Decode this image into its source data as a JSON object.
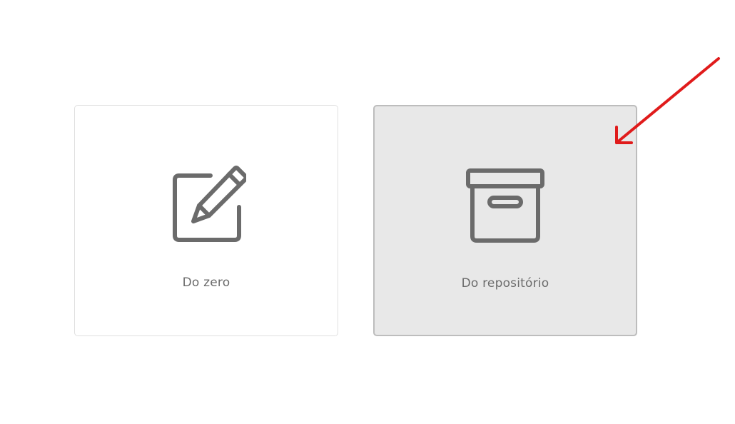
{
  "options": [
    {
      "label": "Do zero",
      "icon": "edit-pencil-square-icon",
      "state": "default"
    },
    {
      "label": "Do repositório",
      "icon": "archive-box-icon",
      "state": "highlighted"
    }
  ],
  "colors": {
    "card_default_bg": "#ffffff",
    "card_default_border": "#e0e0e0",
    "card_highlight_bg": "#e8e8e8",
    "card_highlight_border": "#bdbdbd",
    "icon_stroke": "#6b6b6b",
    "label_text": "#6b6b6b",
    "annotation_arrow": "#e01b1b"
  }
}
